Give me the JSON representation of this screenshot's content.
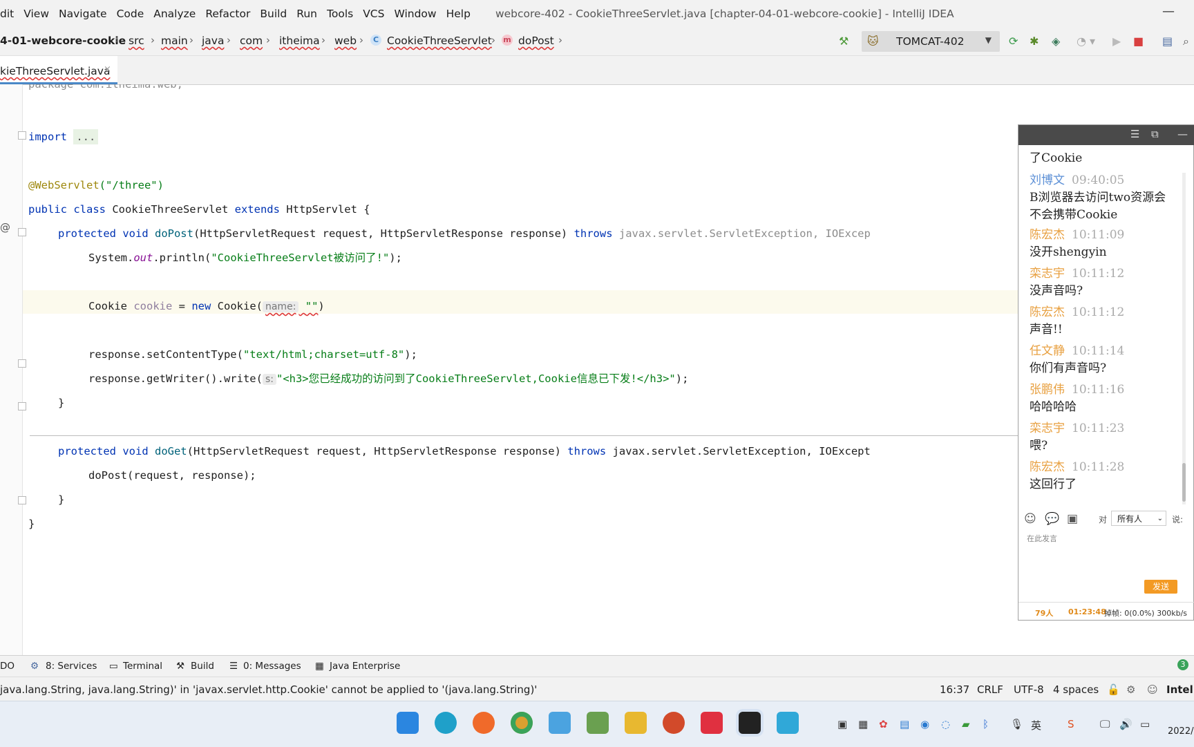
{
  "menu": [
    "dit",
    "View",
    "Navigate",
    "Code",
    "Analyze",
    "Refactor",
    "Build",
    "Run",
    "Tools",
    "VCS",
    "Window",
    "Help"
  ],
  "window_title": "webcore-402 - CookieThreeServlet.java [chapter-04-01-webcore-cookie] - IntelliJ IDEA",
  "breadcrumb": {
    "project": "4-01-webcore-cookie",
    "items": [
      "src",
      "main",
      "java",
      "com",
      "itheima",
      "web"
    ],
    "class_icon": "C",
    "class": "CookieThreeServlet",
    "method_icon": "m",
    "method": "doPost"
  },
  "run_config": "TOMCAT-402",
  "tab": {
    "label": "kieThreeServlet.java",
    "close": "×"
  },
  "code": {
    "l0": "package com.itheima.web;",
    "import_kw": "import",
    "import_fold": "...",
    "annotation": "@WebServlet",
    "annotation_arg": "(\"/three\")",
    "class_decl_1": "public class ",
    "class_name": "CookieThreeServlet ",
    "extends_kw": "extends ",
    "super_name": "HttpServlet {",
    "dopost_mod": "protected void ",
    "dopost_name": "doPost",
    "dopost_params": "(HttpServletRequest request, HttpServletResponse response) ",
    "throws_kw": "throws ",
    "dopost_exc": "javax.servlet.ServletException, IOExcep",
    "println_pre": "System.",
    "println_out": "out",
    "println_mid": ".println(",
    "println_str": "\"CookieThreeServlet被访问了!\"",
    "println_end": ");",
    "cookie_type": "Cookie ",
    "cookie_var": "cookie",
    "cookie_eq": " = ",
    "new_kw": "new ",
    "cookie_ctor": "Cookie(",
    "cookie_hint": "name:",
    "cookie_str": "\"\"",
    "cookie_end": ")",
    "setct_pre": "response.setContentType(",
    "setct_str": "\"text/html;charset=utf-8\"",
    "setct_end": ");",
    "write_pre": "response.getWriter().write(",
    "write_hint": "s:",
    "write_str": "\"<h3>您已经成功的访问到了CookieThreeServlet,Cookie信息已下发!</h3>\"",
    "write_end": ");",
    "close1": "}",
    "doget_mod": "protected void ",
    "doget_name": "doGet",
    "doget_params": "(HttpServletRequest request, HttpServletResponse response) ",
    "doget_throws": "throws ",
    "doget_exc": "javax.servlet.ServletException, IOExcept",
    "dopost_call": "doPost(request, response);",
    "close2": "}",
    "close3": "}"
  },
  "chat": {
    "messages": [
      {
        "name": "",
        "time": "",
        "text": "了Cookie",
        "color": "#222222"
      },
      {
        "name": "刘博文",
        "time": "09:40:05",
        "text": "B浏览器去访问two资源会",
        "text2": "不会携带Cookie",
        "color": "#5b8fd6"
      },
      {
        "name": "陈宏杰",
        "time": "10:11:09",
        "text": "没开shengyin",
        "color": "#e8a040"
      },
      {
        "name": "栾志宇",
        "time": "10:11:12",
        "text": "没声音吗?",
        "color": "#e8a040"
      },
      {
        "name": "陈宏杰",
        "time": "10:11:12",
        "text": "声音!!",
        "color": "#e8a040"
      },
      {
        "name": "任文静",
        "time": "10:11:14",
        "text": "你们有声音吗?",
        "color": "#e8a040"
      },
      {
        "name": "张鹏伟",
        "time": "10:11:16",
        "text": "哈哈哈哈",
        "color": "#e8a040"
      },
      {
        "name": "栾志宇",
        "time": "10:11:23",
        "text": "喂?",
        "color": "#e8a040"
      },
      {
        "name": "陈宏杰",
        "time": "10:11:28",
        "text": "这回行了",
        "color": "#e8a040"
      }
    ],
    "to_label": "对",
    "recipient": "所有人",
    "say_label": "说:",
    "input_placeholder": "在此发言",
    "send": "发送",
    "people": "79人",
    "elapsed": "01:23:48",
    "stats": "掉帧: 0(0.0%) 300kb/s"
  },
  "tool_windows": [
    "DO",
    "8: Services",
    "Terminal",
    "Build",
    "0: Messages",
    "Java Enterprise"
  ],
  "tool_badge": "3",
  "status": {
    "message": "java.lang.String, java.lang.String)' in 'javax.servlet.http.Cookie' cannot be applied to '(java.lang.String)'",
    "position": "16:37",
    "line_sep": "CRLF",
    "encoding": "UTF-8",
    "indent": "4 spaces",
    "brand": "Intelli"
  },
  "clock": "2022/"
}
